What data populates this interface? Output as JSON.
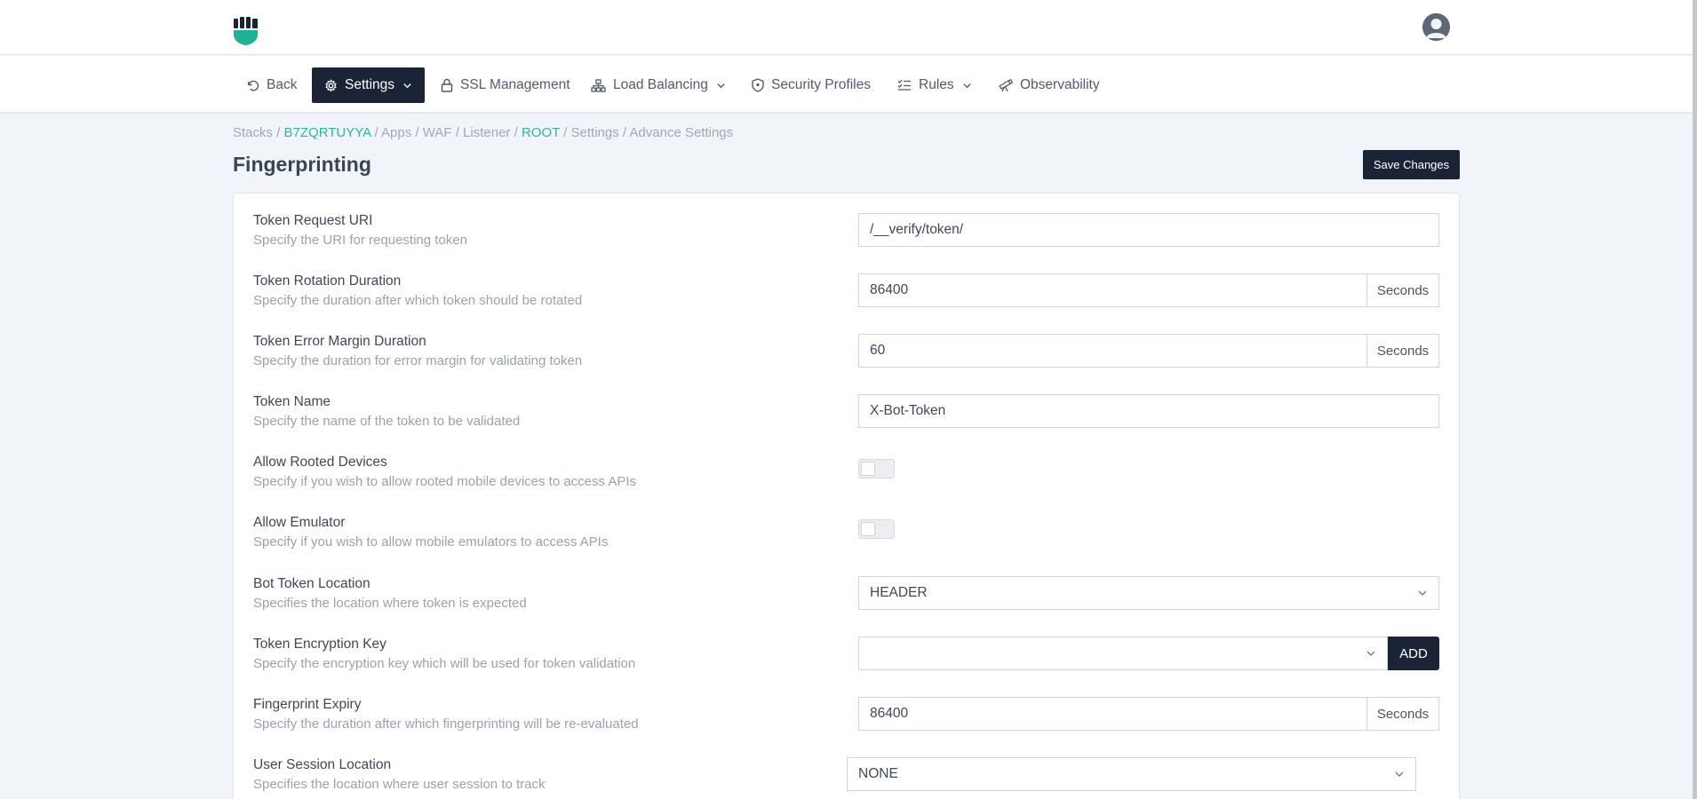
{
  "header": {
    "brand_color": "#1ab394"
  },
  "nav": {
    "back": "Back",
    "settings": "Settings",
    "ssl": "SSL Management",
    "load_balancing": "Load Balancing",
    "security_profiles": "Security Profiles",
    "rules": "Rules",
    "observability": "Observability"
  },
  "breadcrumb": {
    "stacks": "Stacks",
    "stack_id": "B7ZQRTUYYA",
    "apps": "Apps",
    "waf": "WAF",
    "listener": "Listener",
    "root": "ROOT",
    "settings": "Settings",
    "advance": "Advance Settings",
    "separator": "/"
  },
  "page": {
    "title": "Fingerprinting",
    "save_label": "Save Changes"
  },
  "fields": {
    "token_uri": {
      "label": "Token Request URI",
      "desc": "Specify the URI for requesting token",
      "value": "/__verify/token/"
    },
    "rotation": {
      "label": "Token Rotation Duration",
      "desc": "Specify the duration after which token should be rotated",
      "value": "86400",
      "unit": "Seconds"
    },
    "error_margin": {
      "label": "Token Error Margin Duration",
      "desc": "Specify the duration for error margin for validating token",
      "value": "60",
      "unit": "Seconds"
    },
    "token_name": {
      "label": "Token Name",
      "desc": "Specify the name of the token to be validated",
      "value": "X-Bot-Token"
    },
    "rooted": {
      "label": "Allow Rooted Devices",
      "desc": "Specify if you wish to allow rooted mobile devices to access APIs",
      "enabled": false
    },
    "emulator": {
      "label": "Allow Emulator",
      "desc": "Specify if you wish to allow mobile emulators to access APIs",
      "enabled": false
    },
    "bot_location": {
      "label": "Bot Token Location",
      "desc": "Specifies the location where token is expected",
      "value": "HEADER"
    },
    "encryption_key": {
      "label": "Token Encryption Key",
      "desc": "Specify the encryption key which will be used for token validation",
      "value": "",
      "add_label": "ADD"
    },
    "fp_expiry": {
      "label": "Fingerprint Expiry",
      "desc": "Specify the duration after which fingerprinting will be re-evaluated",
      "value": "86400",
      "unit": "Seconds"
    },
    "session_location": {
      "label": "User Session Location",
      "desc": "Specifies the location where user session to track",
      "value": "NONE"
    }
  }
}
